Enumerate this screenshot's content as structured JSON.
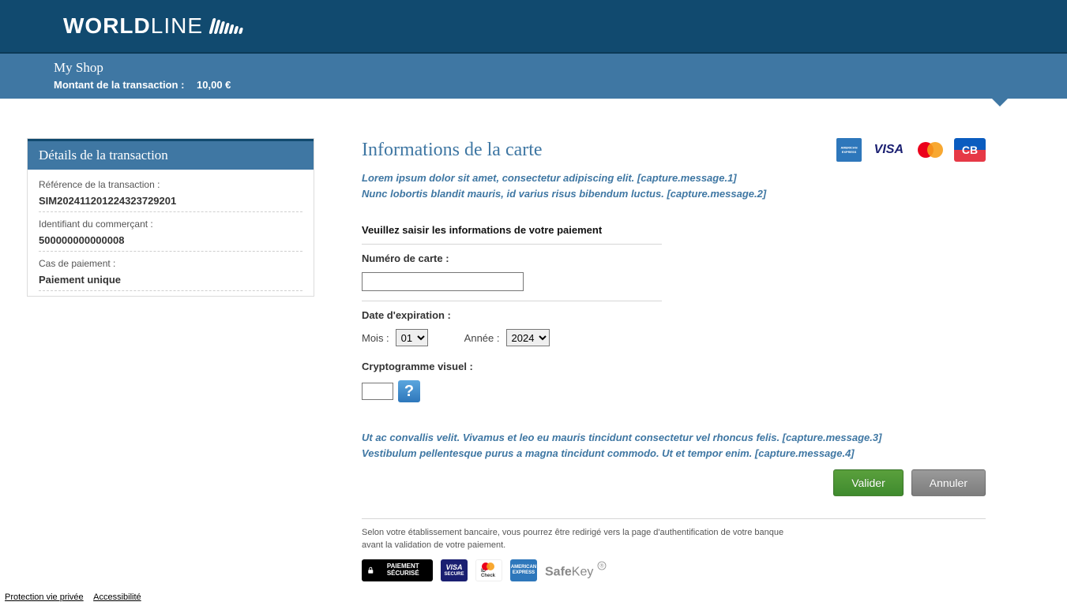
{
  "logo": {
    "part1": "WORLD",
    "part2": "LINE"
  },
  "shop": {
    "name": "My Shop",
    "tx_amount_label": "Montant de la transaction  :",
    "tx_amount_value": "10,00 €"
  },
  "sidebar": {
    "title": "Détails de la transaction",
    "rows": [
      {
        "label": "Référence de la transaction :",
        "value": "SIM202411201224323729201"
      },
      {
        "label": "Identifiant du commerçant :",
        "value": "500000000000008"
      },
      {
        "label": "Cas de paiement :",
        "value": "Paiement unique"
      }
    ]
  },
  "main": {
    "title": "Informations de la carte",
    "capture_msgs_top": [
      "Lorem ipsum dolor sit amet, consectetur adipiscing elit. [capture.message.1]",
      "Nunc lobortis blandit mauris, id varius risus bibendum luctus. [capture.message.2]"
    ],
    "instruction": "Veuillez saisir les informations de votre paiement",
    "card_number_label": "Numéro de carte :",
    "exp_label": "Date d'expiration :",
    "month_label": "Mois :",
    "month_selected": "01",
    "year_label": "Année :",
    "year_selected": "2024",
    "cvv_label": "Cryptogramme visuel :",
    "cvv_help_text": "?",
    "capture_msgs_bottom": [
      "Ut ac convallis velit. Vivamus et leo eu mauris tincidunt consectetur vel rhoncus felis. [capture.message.3]",
      "Vestibulum pellentesque purus a magna tincidunt commodo. Ut et tempor enim. [capture.message.4]"
    ],
    "validate_label": "Valider",
    "cancel_label": "Annuler",
    "redirect_note": "Selon votre établissement bancaire, vous pourrez être redirigé vers la page d'authentification de votre banque avant la validation de votre paiement."
  },
  "card_brands": {
    "amex": "AMEX",
    "visa": "VISA",
    "cb": "CB"
  },
  "security_logos": {
    "paiement": "PAIEMENT SÉCURISÉ",
    "visa": "VISA SECURE",
    "mc": "ID Check",
    "amex": "AMERICAN EXPRESS",
    "safekey1": "Safe",
    "safekey2": "Key"
  },
  "footer": {
    "privacy": "Protection vie privée",
    "accessibility": "Accessibilité"
  }
}
